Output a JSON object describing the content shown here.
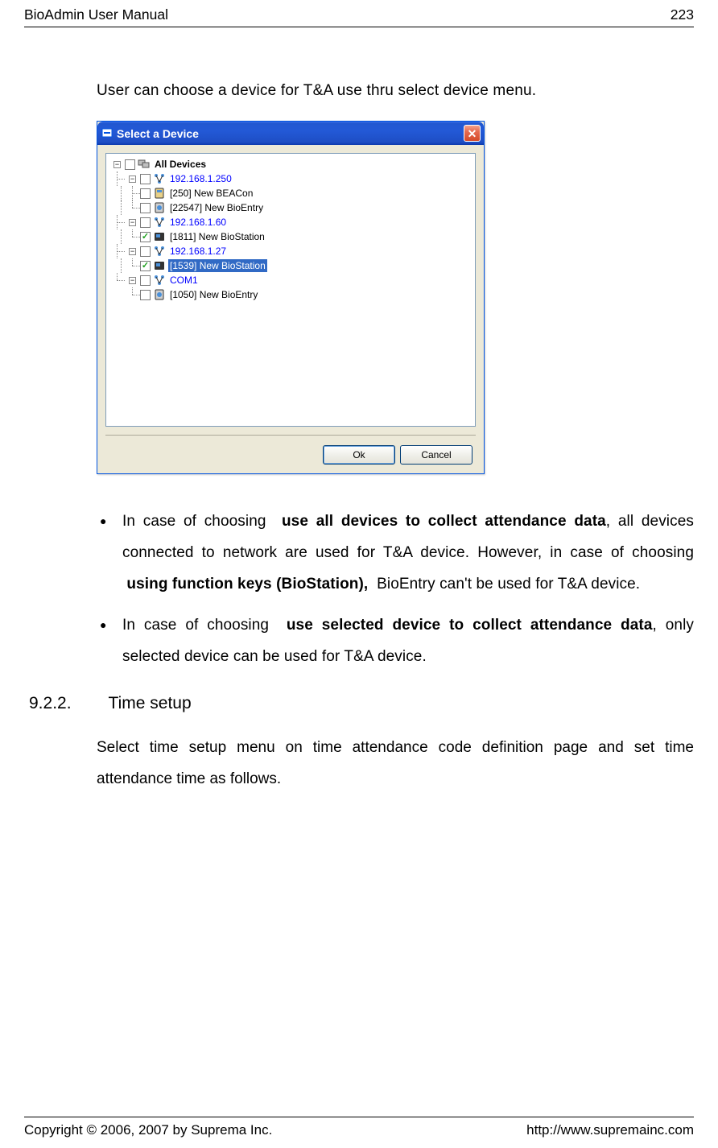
{
  "header": {
    "title": "BioAdmin User Manual",
    "page_number": "223"
  },
  "intro": "User can choose a device for T&A use thru select device menu.",
  "dialog": {
    "title": "Select a Device",
    "root": "All Devices",
    "items": [
      {
        "label": "192.168.1.250",
        "blue": true
      },
      {
        "label": "[250] New BEACon"
      },
      {
        "label": "[22547] New BioEntry"
      },
      {
        "label": "192.168.1.60",
        "blue": true
      },
      {
        "label": "[1811] New BioStation",
        "checked": true
      },
      {
        "label": "192.168.1.27",
        "blue": true
      },
      {
        "label": "[1539] New BioStation",
        "checked": true,
        "selected": true
      },
      {
        "label": "COM1",
        "blue": true
      },
      {
        "label": "[1050] New BioEntry"
      }
    ],
    "ok": "Ok",
    "cancel": "Cancel"
  },
  "bullets": {
    "item1_prefix": "In case of choosing",
    "item1_bold1": "use all devices to collect attendance data",
    "item1_mid": ", all devices connected to network are used for T&A device. However, in case of choosing",
    "item1_bold2": "using function keys (BioStation),",
    "item1_end": "BioEntry can't be used for T&A device.",
    "item2_prefix": "In case of choosing",
    "item2_bold": "use selected device to collect attendance data",
    "item2_end": ", only selected device can be used for T&A device."
  },
  "section": {
    "number": "9.2.2.",
    "title": "Time setup",
    "body": "Select time setup menu on time attendance code definition page and set time attendance time as follows."
  },
  "footer": {
    "copyright": "Copyright © 2006, 2007 by Suprema Inc.",
    "url": "http://www.supremainc.com"
  }
}
